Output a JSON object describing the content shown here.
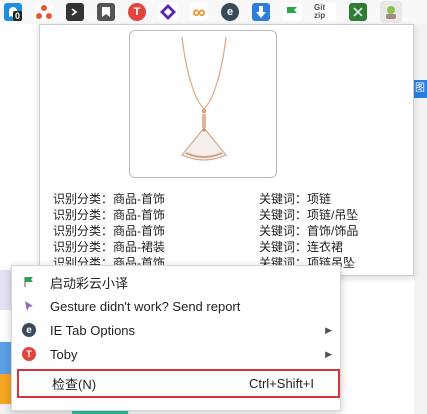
{
  "toolbar": {
    "extensions": [
      {
        "icon": "ghost-icon",
        "color": "#1e8fe0",
        "badge": "0"
      },
      {
        "icon": "network-icon",
        "color": "#e8572e"
      },
      {
        "icon": "terminal-icon",
        "color": "#333333"
      },
      {
        "icon": "bookmark-icon",
        "color": "#555555"
      },
      {
        "icon": "toby-icon",
        "color": "#e2443d"
      },
      {
        "icon": "cube-icon",
        "color": "#5b2aa6"
      },
      {
        "icon": "infinity-icon",
        "color": "#f58a1f"
      },
      {
        "icon": "ie-tab-icon",
        "color": "#3b4a5a"
      },
      {
        "icon": "download-icon",
        "color": "#2d7ed8"
      },
      {
        "icon": "flag-icon",
        "color": "#2aa14a"
      },
      {
        "icon": "gitzip-icon",
        "color": "#555555",
        "label": "Git zip"
      },
      {
        "icon": "puzzle-icon",
        "color": "#2e7d32"
      },
      {
        "icon": "avatar-icon",
        "color": "#dddddd"
      }
    ]
  },
  "popup": {
    "results": [
      {
        "category": "识别分类：商品-首饰",
        "keyword": "关键词：项链"
      },
      {
        "category": "识别分类：商品-首饰",
        "keyword": "关键词：项链/吊坠"
      },
      {
        "category": "识别分类：商品-首饰",
        "keyword": "关键词：首饰/饰品"
      },
      {
        "category": "识别分类：商品-裙装",
        "keyword": "关键词：连衣裙"
      },
      {
        "category": "识别分类：商品-首饰",
        "keyword": "关键词：项链吊坠"
      }
    ]
  },
  "side_tab": "图",
  "menu": {
    "items": [
      {
        "label": "启动彩云小译",
        "icon": "caiyun-flag-icon",
        "color": "#2aa14a"
      },
      {
        "label": "Gesture didn't work? Send report",
        "icon": "gesture-icon",
        "color": "#8a6bbd"
      },
      {
        "label": "IE Tab Options",
        "icon": "ie-tab-icon",
        "color": "#3b4a5a",
        "submenu": true
      },
      {
        "label": "Toby",
        "icon": "toby-icon",
        "color": "#e2443d",
        "submenu": true
      }
    ],
    "inspect": {
      "label": "检查(N)",
      "shortcut": "Ctrl+Shift+I"
    },
    "highlight_color": "#d9343c"
  }
}
